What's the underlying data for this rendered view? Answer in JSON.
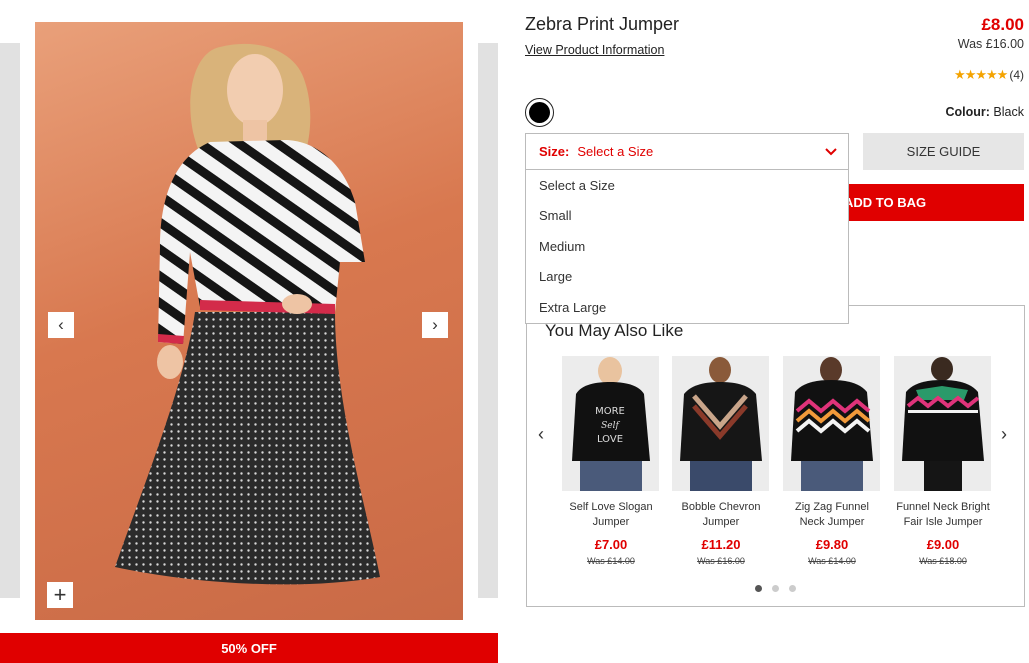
{
  "gallery": {
    "prev_icon": "‹",
    "next_icon": "›",
    "zoom_icon": "+",
    "discount_label": "50% OFF"
  },
  "product": {
    "title": "Zebra Print Jumper",
    "info_link": "View Product Information",
    "price": "£8.00",
    "was_price": "Was £16.00",
    "rating_stars": 5,
    "rating_count": "(4)",
    "colour_label": "Colour:",
    "colour_value": "Black",
    "swatch_color": "#000000"
  },
  "size": {
    "label": "Size:",
    "selected": "Select a Size",
    "guide_label": "SIZE GUIDE",
    "options": [
      "Select a Size",
      "Small",
      "Medium",
      "Large",
      "Extra Large"
    ]
  },
  "bag": {
    "add_label": "ADD TO BAG"
  },
  "recommendations": {
    "title": "You May Also Like",
    "prev_icon": "‹",
    "next_icon": "›",
    "items": [
      {
        "name": "Self Love Slogan Jumper",
        "price": "£7.00",
        "was": "Was £14.00"
      },
      {
        "name": "Bobble Chevron Jumper",
        "price": "£11.20",
        "was": "Was £16.00"
      },
      {
        "name": "Zig Zag Funnel Neck Jumper",
        "price": "£9.80",
        "was": "Was £14.00"
      },
      {
        "name": "Funnel Neck Bright Fair Isle Jumper",
        "price": "£9.00",
        "was": "Was £18.00"
      }
    ],
    "pages": 3,
    "active_page": 1
  },
  "colors": {
    "accent": "#e00000",
    "star": "#f4a300"
  }
}
